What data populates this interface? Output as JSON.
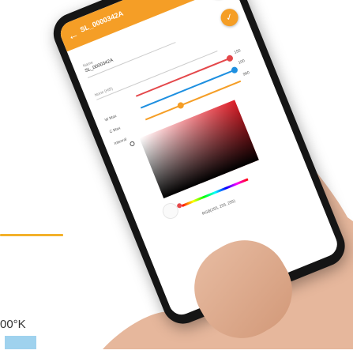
{
  "app": {
    "title": "SL_0000342A",
    "fab_check_label": "✓",
    "back_label": "←"
  },
  "fields": {
    "name_label": "Name",
    "name_value": "SL_0000342A",
    "group_label": "None (Hi5)"
  },
  "sliders": [
    {
      "label": "",
      "value_text": "150"
    },
    {
      "label": "W Max",
      "value_text": "100"
    },
    {
      "label": "C Max",
      "value_text": "960"
    },
    {
      "label": "Interval",
      "value_text": ""
    }
  ],
  "picker": {
    "rgb_text": "RGB(255, 255, 255)"
  },
  "overlay": {
    "kelvin_text": "00°K",
    "swatch_color": "#9fd2ee"
  },
  "colors": {
    "accent": "#f59e26",
    "slider_red": "#e4474a",
    "slider_blue": "#1d8fe0",
    "slider_orange": "#f59e26",
    "gold_line": "#f3b12a"
  }
}
